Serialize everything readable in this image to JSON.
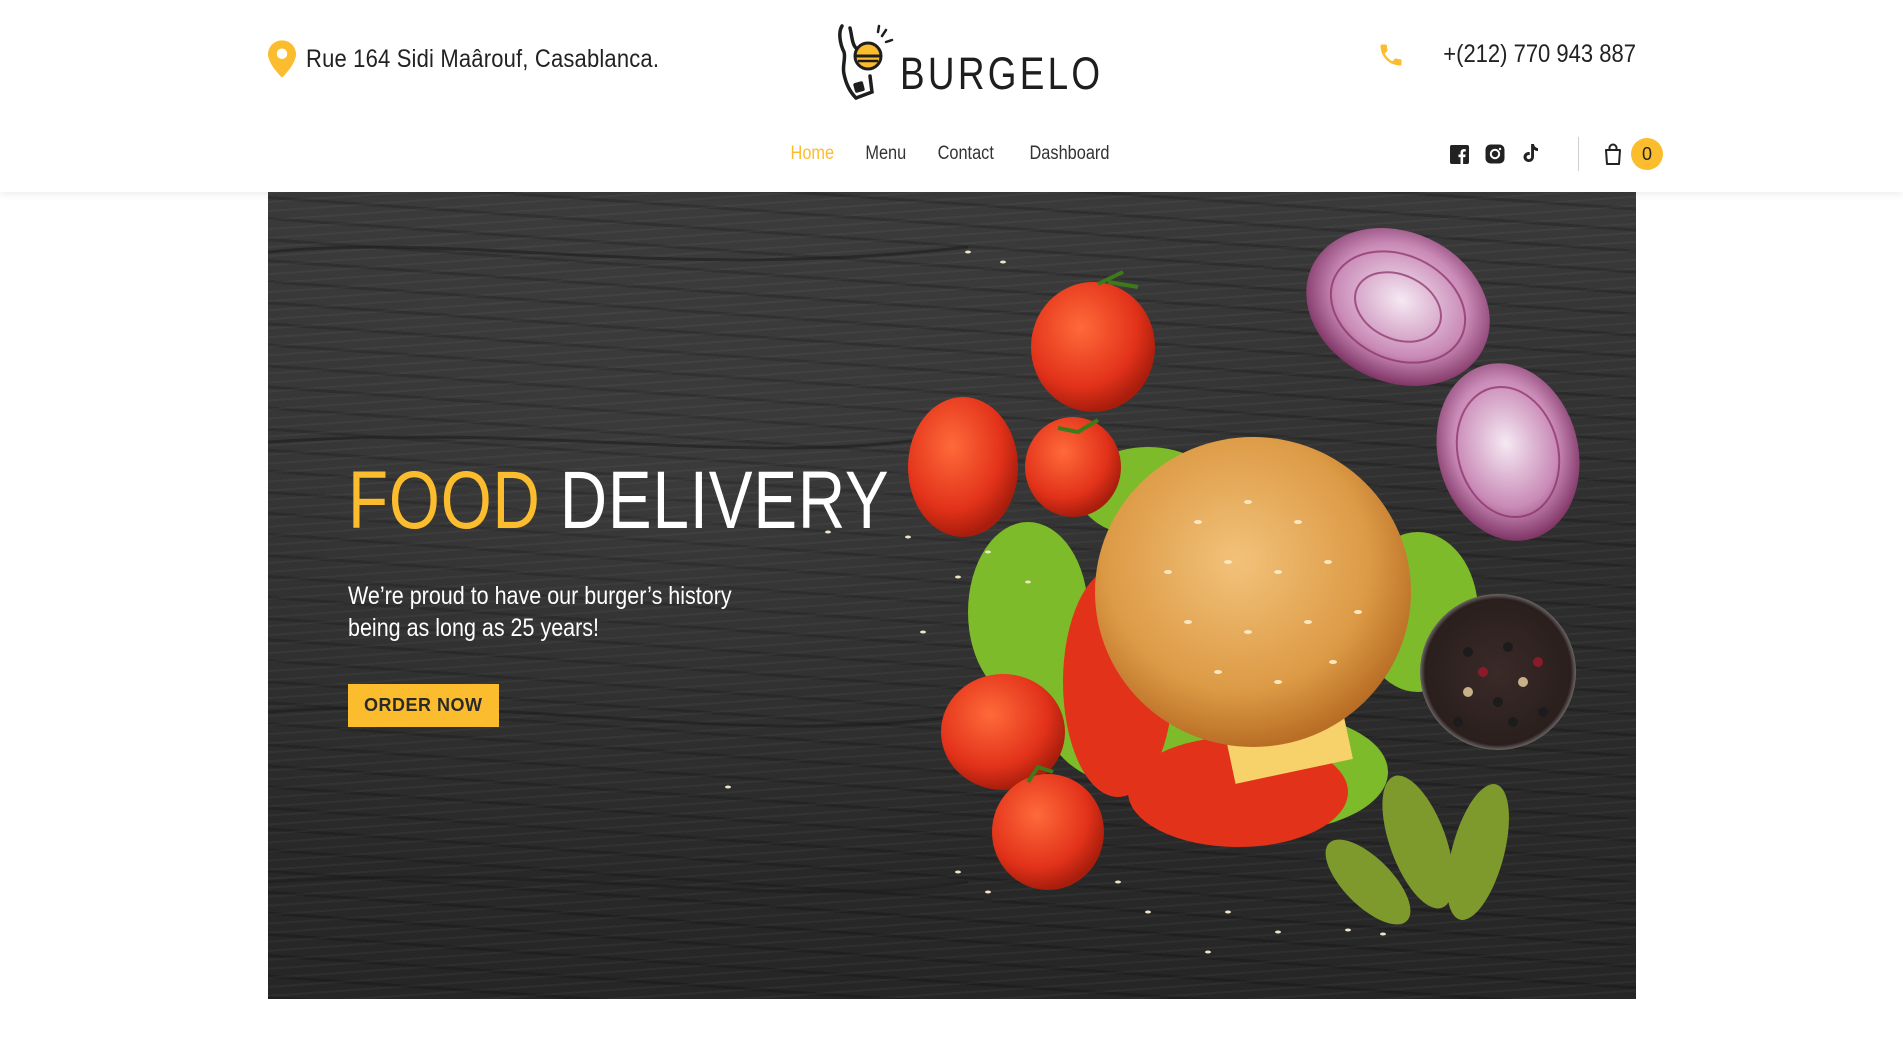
{
  "header": {
    "address": "Rue 164 Sidi Maârouf, Casablanca.",
    "logo_text": "BURGELO",
    "phone": "+(212) 770 943 887"
  },
  "nav": {
    "items": [
      {
        "label": "Home",
        "active": true
      },
      {
        "label": "Menu",
        "active": false
      },
      {
        "label": "Contact",
        "active": false
      },
      {
        "label": "Dashboard",
        "active": false
      }
    ],
    "social_icons": [
      "facebook-icon",
      "instagram-icon",
      "tiktok-icon"
    ],
    "cart_count": "0"
  },
  "hero": {
    "title_accent": "FOOD",
    "title_main": "DELIVERY",
    "text": "We’re proud to have our burger’s history being as long as 25 years!",
    "button_label": "ORDER NOW"
  },
  "colors": {
    "accent": "#fbbd2e",
    "dark": "#2e2e2e",
    "text": "#222222"
  }
}
